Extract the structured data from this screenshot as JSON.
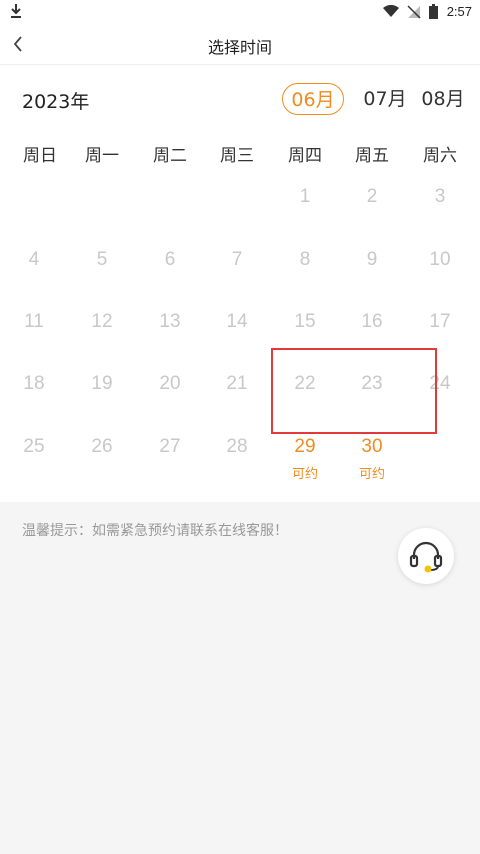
{
  "status_bar": {
    "time": "2:57"
  },
  "header": {
    "title": "选择时间"
  },
  "calendar": {
    "year": "2023年",
    "months": [
      {
        "label": "06月",
        "active": true
      },
      {
        "label": "07月",
        "active": false
      },
      {
        "label": "08月",
        "active": false
      }
    ],
    "weekdays": [
      "周日",
      "周一",
      "周二",
      "周三",
      "周四",
      "周五",
      "周六"
    ],
    "days": [
      "1",
      "2",
      "3",
      "4",
      "5",
      "6",
      "7",
      "8",
      "9",
      "10",
      "11",
      "12",
      "13",
      "14",
      "15",
      "16",
      "17",
      "18",
      "19",
      "20",
      "21",
      "22",
      "23",
      "24",
      "25",
      "26",
      "27",
      "28",
      "29",
      "30"
    ],
    "available": {
      "29": "可约",
      "30": "可约"
    }
  },
  "tip": "温馨提示：如需紧急预约请联系在线客服！",
  "colors": {
    "accent": "#f08c1e",
    "disabled": "#c8c8c8",
    "highlight_border": "#e23a3a"
  },
  "icons": {
    "back": "back-arrow-icon",
    "service": "headset-icon"
  }
}
